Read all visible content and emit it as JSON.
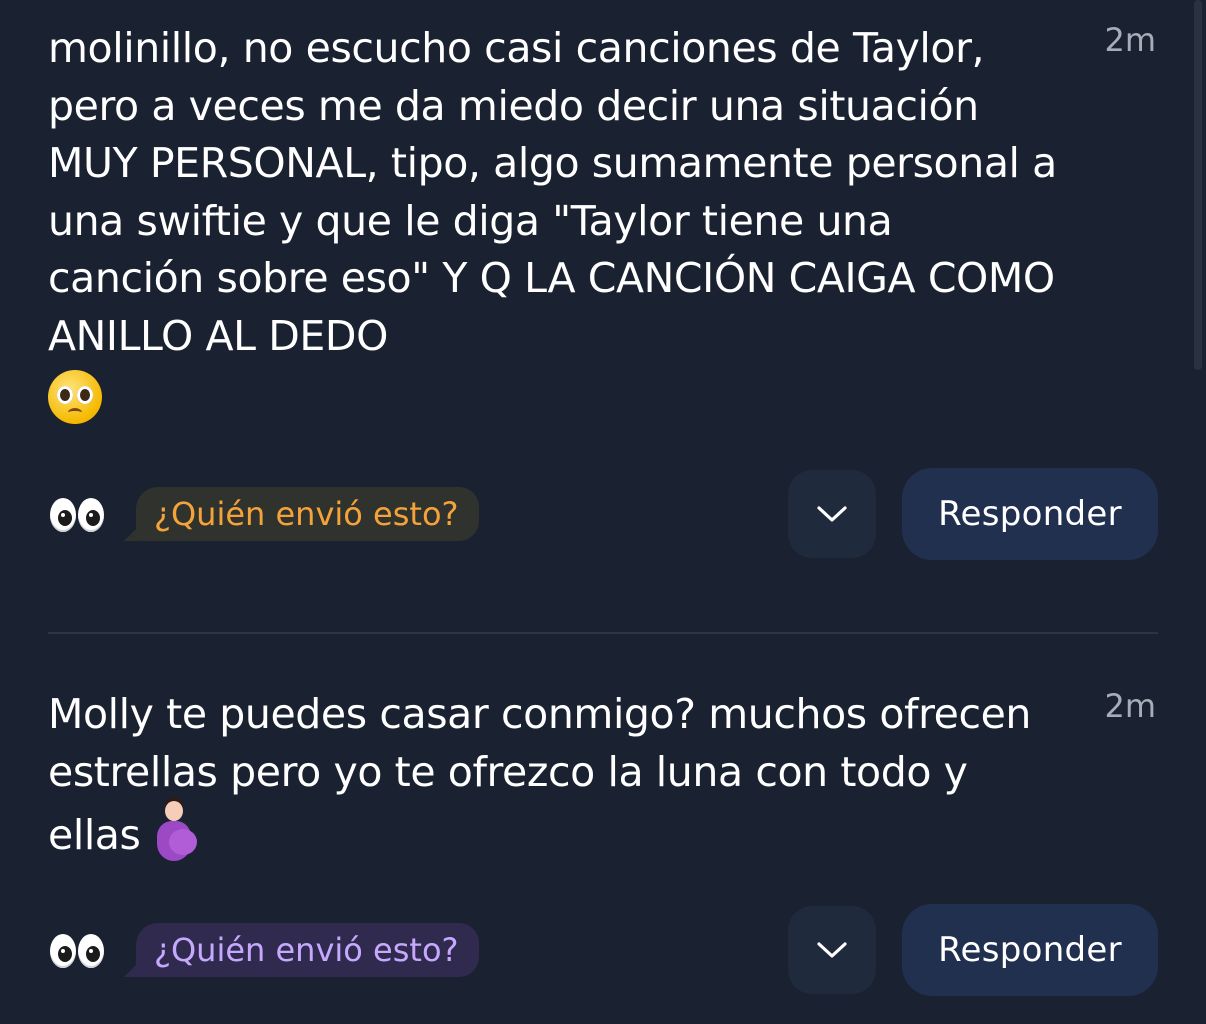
{
  "messages": [
    {
      "text": "molinillo, no escucho casi canciones de Taylor, pero a veces me da miedo decir una situación MUY PERSONAL, tipo, algo sumamente personal a una swiftie y que le diga \"Taylor tiene una canción sobre eso\" Y Q LA CANCIÓN CAIGA COMO ANILLO AL DEDO",
      "emoji_icon": "pleading-face-emoji",
      "time": "2m",
      "who_label": "¿Quién envió esto?",
      "who_color": "#f4a23a",
      "reply_label": "Responder"
    },
    {
      "text": "Molly te puedes casar conmigo? muchos ofrecen estrellas pero yo te ofrezco la luna con todo y ellas",
      "emoji_icon": "pregnant-woman-emoji",
      "time": "2m",
      "who_label": "¿Quién envió esto?",
      "who_color": "#c6a9ff",
      "reply_label": "Responder"
    }
  ],
  "icons": {
    "eyes": "eyes-icon",
    "expand": "chevron-down-icon"
  },
  "colors": {
    "background": "#1a2130",
    "reply_button": "#223050",
    "timestamp": "#a7adb8"
  }
}
